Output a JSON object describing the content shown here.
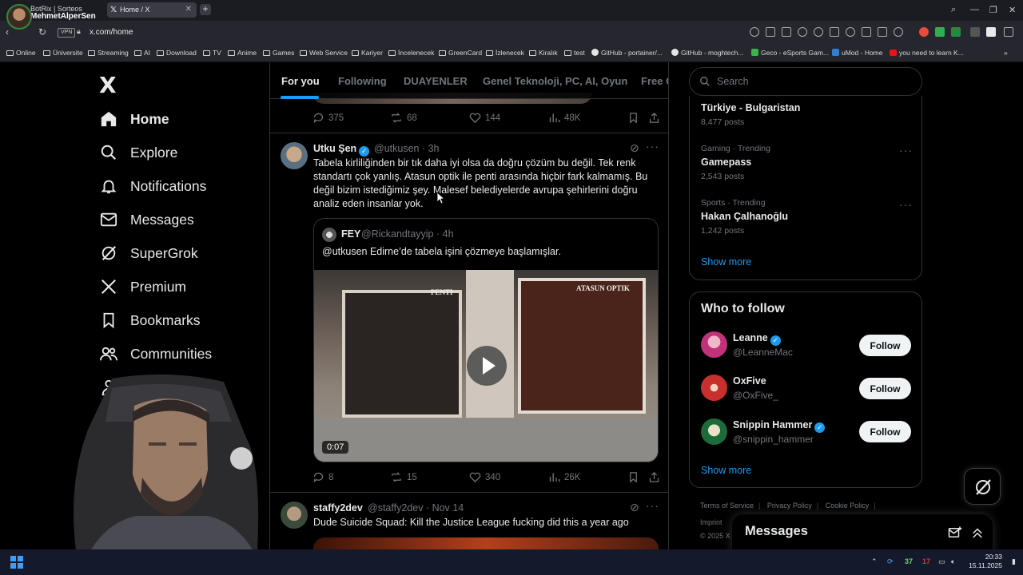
{
  "browser": {
    "profile": {
      "title": "BotRix | Sorteos",
      "name": "MehmetAlperSen"
    },
    "tab_title": "Home / X",
    "url": "x.com/home",
    "vpn_label": "VPN",
    "bookmarks": [
      "Online",
      "Üniversite",
      "Streaming",
      "AI",
      "Download",
      "TV",
      "Anime",
      "Games",
      "Web Service",
      "Kariyer",
      "İncelenecek",
      "GreenCard",
      "İzlenecek",
      "Kiralık",
      "test",
      "GitHub - portainer/...",
      "GitHub - moghtech...",
      "Geco - eSports Gam...",
      "uMod - Home",
      "you need to learn K..."
    ]
  },
  "nav": {
    "logo": "X",
    "items": [
      {
        "label": "Home",
        "icon": "home-icon"
      },
      {
        "label": "Explore",
        "icon": "search-icon"
      },
      {
        "label": "Notifications",
        "icon": "bell-icon"
      },
      {
        "label": "Messages",
        "icon": "envelope-icon"
      },
      {
        "label": "SuperGrok",
        "icon": "grok-icon"
      },
      {
        "label": "Premium",
        "icon": "x-icon"
      },
      {
        "label": "Bookmarks",
        "icon": "bookmark-icon"
      },
      {
        "label": "Communities",
        "icon": "people-icon"
      }
    ]
  },
  "feed": {
    "tabs": [
      "For you",
      "Following",
      "DUAYENLER",
      "Genel Teknoloji, PC, AI, Oyun",
      "Free G"
    ],
    "prev_stats": {
      "replies": "375",
      "reposts": "68",
      "likes": "144",
      "views": "48K"
    },
    "tweet1": {
      "name": "Utku Şen",
      "handle": "@utkusen",
      "time": "3h",
      "text": "Tabela kirliliğinden bir tık daha iyi olsa da doğru çözüm bu değil. Tek renk standartı çok yanlış. Atasun optik ile penti arasında hiçbir fark kalmamış. Bu değil bizim istediğimiz şey. Malesef belediyelerde avrupa şehirlerini doğru analiz eden insanlar yok.",
      "quote": {
        "name": "FEY",
        "handle": "@Rickandtayyip",
        "time": "4h",
        "text": "@utkusen Edirne’de tabela işini çözmeye başlamışlar.",
        "sign_left": "PENTI",
        "sign_right": "ATASUN OPTIK",
        "video_time": "0:07"
      },
      "stats": {
        "replies": "8",
        "reposts": "15",
        "likes": "340",
        "views": "26K"
      }
    },
    "tweet2": {
      "name": "staffy2dev",
      "handle": "@staffy2dev",
      "time": "Nov 14",
      "text": "Dude Suicide Squad: Kill the Justice League fucking did this a year ago"
    }
  },
  "right": {
    "search_placeholder": "Search",
    "trends": [
      {
        "meta": "",
        "title": "Türkiye - Bulgaristan",
        "count": "8,477 posts"
      },
      {
        "meta": "Gaming · Trending",
        "title": "Gamepass",
        "count": "2,543 posts"
      },
      {
        "meta": "Sports · Trending",
        "title": "Hakan Çalhanoğlu",
        "count": "1,242 posts"
      }
    ],
    "show_more": "Show more",
    "who_to_follow": {
      "title": "Who to follow",
      "users": [
        {
          "name": "Leanne",
          "handle": "@LeanneMac",
          "button": "Follow"
        },
        {
          "name": "OxFive",
          "handle": "@OxFive_",
          "button": "Follow"
        },
        {
          "name": "Snippin Hammer",
          "handle": "@snippin_hammer",
          "button": "Follow"
        }
      ],
      "show_more": "Show more"
    },
    "footer": [
      "Terms of Service",
      "Privacy Policy",
      "Cookie Policy",
      "Imprint",
      "© 2025 X C"
    ],
    "messages_title": "Messages"
  },
  "taskbar": {
    "time": "20:33",
    "date": "15.11.2025",
    "badge1": "37",
    "badge2": "17"
  },
  "colors": {
    "accent": "#1d9bf0",
    "background": "#000000",
    "text": "#e7e9ea",
    "muted": "#71767b"
  }
}
